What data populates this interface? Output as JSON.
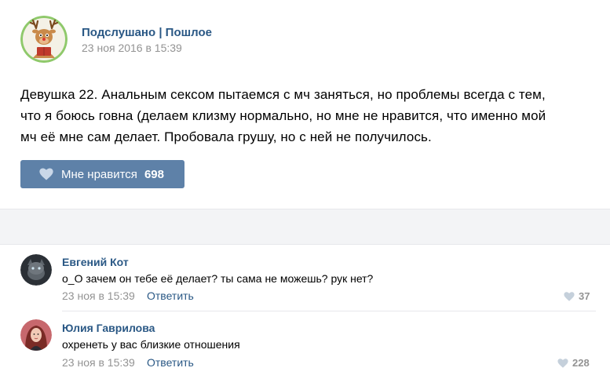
{
  "post": {
    "author": "Подслушано | Пошлое",
    "date": "23 ноя 2016 в 15:39",
    "text_lines": [
      "Девушка 22. Анальным сексом пытаемся с мч заняться, но проблемы всегда с тем,",
      "что я боюсь говна (делаем клизму нормально, но мне не нравится, что именно мой",
      "мч её мне сам делает. Пробовала грушу, но с ней не получилось."
    ],
    "like_label": "Мне нравится",
    "like_count": "698",
    "avatar_icon": "reindeer-avatar"
  },
  "comments": [
    {
      "author": "Евгений Кот",
      "text": "о_О зачем он тебе её делает? ты сама не можешь? рук нет?",
      "date": "23 ноя в 15:39",
      "reply_label": "Ответить",
      "likes": "37"
    },
    {
      "author": "Юлия Гаврилова",
      "text": "охренеть у вас близкие отношения",
      "date": "23 ноя в 15:39",
      "reply_label": "Ответить",
      "likes": "228"
    }
  ],
  "colors": {
    "link": "#2a5885",
    "muted": "#939393",
    "like_button": "#5e81a8"
  }
}
